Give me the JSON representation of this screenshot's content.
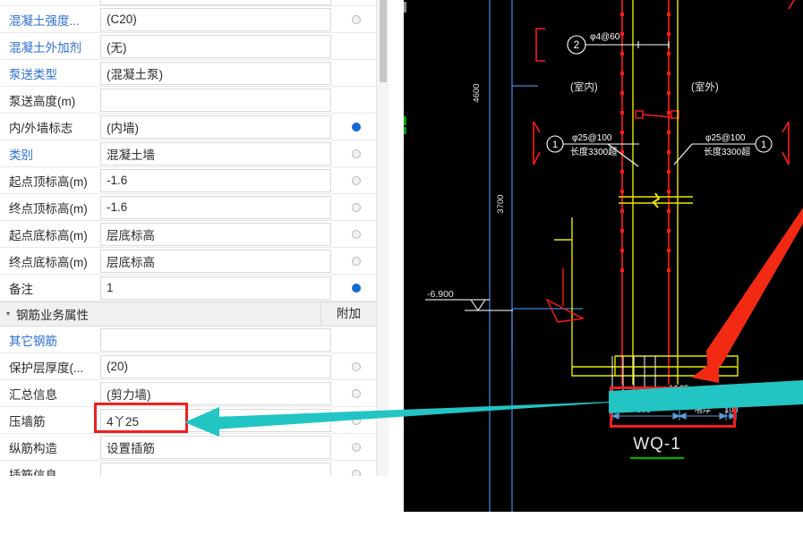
{
  "panel": {
    "section_header": {
      "caret": "▾",
      "title": "钢筋业务属性",
      "extra_column": "附加"
    },
    "rows_top": [
      {
        "label": "混凝土强度...",
        "value": "(C20)",
        "label_blue": true,
        "dot": "empty"
      },
      {
        "label": "混凝土外加剂",
        "value": "(无)",
        "label_blue": true,
        "dot": "none"
      },
      {
        "label": "泵送类型",
        "value": "(混凝土泵)",
        "label_blue": true,
        "dot": "none"
      },
      {
        "label": "泵送高度(m)",
        "value": "",
        "label_blue": false,
        "dot": "none"
      },
      {
        "label": "内/外墙标志",
        "value": "(内墙)",
        "label_blue": false,
        "dot": "filled"
      },
      {
        "label": "类别",
        "value": "混凝土墙",
        "label_blue": true,
        "dot": "empty"
      },
      {
        "label": "起点顶标高(m)",
        "value": "-1.6",
        "label_blue": false,
        "dot": "empty"
      },
      {
        "label": "终点顶标高(m)",
        "value": "-1.6",
        "label_blue": false,
        "dot": "empty"
      },
      {
        "label": "起点底标高(m)",
        "value": "层底标高",
        "label_blue": false,
        "dot": "empty"
      },
      {
        "label": "终点底标高(m)",
        "value": "层底标高",
        "label_blue": false,
        "dot": "empty"
      },
      {
        "label": "备注",
        "value": "1",
        "label_blue": false,
        "dot": "filled"
      }
    ],
    "rows_bottom": [
      {
        "label": "其它钢筋",
        "value": "",
        "label_blue": true,
        "dot": "none"
      },
      {
        "label": "保护层厚度(...",
        "value": "(20)",
        "label_blue": false,
        "dot": "empty"
      },
      {
        "label": "汇总信息",
        "value": "(剪力墙)",
        "label_blue": false,
        "dot": "empty"
      },
      {
        "label": "压墙筋",
        "value": "4丫25",
        "label_blue": false,
        "dot": "empty"
      },
      {
        "label": "纵筋构造",
        "value": "设置插筋",
        "label_blue": false,
        "dot": "empty"
      },
      {
        "label": "插筋信息",
        "value": "",
        "label_blue": false,
        "dot": "empty"
      }
    ]
  },
  "cad": {
    "title": "WQ-1",
    "room_inside": "(室内)",
    "room_outside": "(室外)",
    "elevation_mark": "-6.900",
    "dim_vertical_top": "4600",
    "dim_vertical_bottom": "3700",
    "callout_2_number": "2",
    "callout_2_text": "φ4@60",
    "callout_1_left_number": "1",
    "callout_1_left_text": "φ25@100",
    "callout_1_left_text2": "长度3300超",
    "callout_1_right_number": "1",
    "callout_1_right_text": "φ25@100",
    "callout_1_right_text2": "长度3300超",
    "footing_rebar_label": "4Φ25",
    "dim_500": "500",
    "dim_mid": "墙厚",
    "dim_100": "100"
  },
  "annotations": {
    "highlight_color": "#ee2020",
    "arrow_color": "#22c4c4",
    "pointer_color": "#f22a14",
    "note": "4丫25"
  }
}
